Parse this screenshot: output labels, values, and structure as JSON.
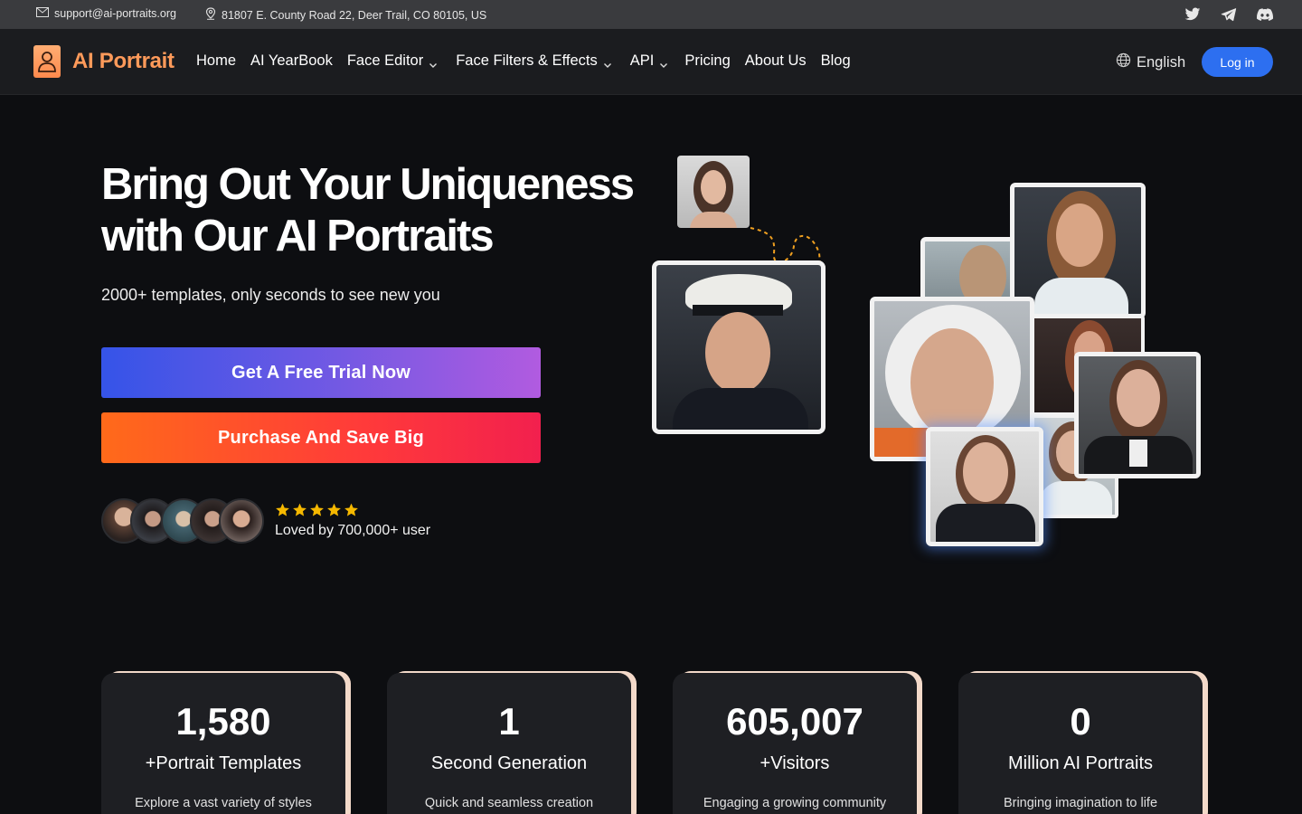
{
  "topbar": {
    "email": "support@ai-portraits.org",
    "address": "81807 E. County Road 22, Deer Trail, CO 80105, US",
    "icons": [
      "mail-icon",
      "location-pin-icon",
      "twitter-icon",
      "telegram-icon",
      "discord-icon"
    ]
  },
  "nav": {
    "brand": "AI Portrait",
    "items": [
      {
        "label": "Home",
        "dropdown": false
      },
      {
        "label": "AI YearBook",
        "dropdown": false
      },
      {
        "label": "Face Editor",
        "dropdown": true
      },
      {
        "label": "Face Filters & Effects",
        "dropdown": true
      },
      {
        "label": "API",
        "dropdown": true
      },
      {
        "label": "Pricing",
        "dropdown": false
      },
      {
        "label": "About Us",
        "dropdown": false
      },
      {
        "label": "Blog",
        "dropdown": false
      }
    ],
    "language": "English",
    "login": "Log in"
  },
  "hero": {
    "headline_line1": "Bring Out Your Uniqueness",
    "headline_line2": "with Our AI Portraits",
    "subtitle": "2000+ templates, only seconds to see new you",
    "cta_trial": "Get A Free Trial Now",
    "cta_purchase": "Purchase And Save Big",
    "rating_stars": 5,
    "loved_by": "Loved by 700,000+ user"
  },
  "stats": [
    {
      "number": "1,580",
      "label": "+Portrait Templates",
      "desc": "Explore a vast variety of styles"
    },
    {
      "number": "1",
      "label": "Second Generation",
      "desc": "Quick and seamless creation"
    },
    {
      "number": "605,007",
      "label": "+Visitors",
      "desc": "Engaging a growing community"
    },
    {
      "number": "0",
      "label": "Million AI Portraits",
      "desc": "Bringing imagination to life"
    }
  ],
  "colors": {
    "brand": "#ff9a5a",
    "login_bg": "#2d6ff0",
    "star": "#f5b800"
  }
}
